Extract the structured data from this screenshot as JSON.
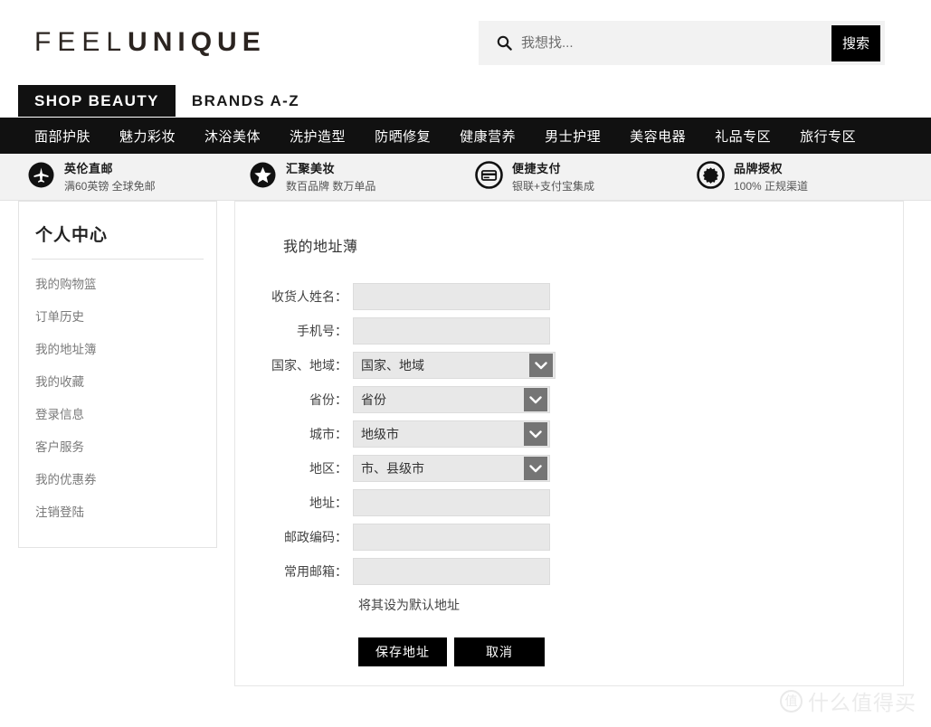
{
  "header": {
    "logo_light": "FEEL",
    "logo_bold": "UNIQUE",
    "search": {
      "placeholder": "我想找...",
      "value": "",
      "button_label": "搜索",
      "icon": "search-icon"
    }
  },
  "tabs": [
    {
      "label": "SHOP BEAUTY",
      "active": true
    },
    {
      "label": "BRANDS A-Z",
      "active": false
    }
  ],
  "nav": {
    "items": [
      {
        "label": "面部护肤"
      },
      {
        "label": "魅力彩妆"
      },
      {
        "label": "沐浴美体"
      },
      {
        "label": "洗护造型"
      },
      {
        "label": "防晒修复"
      },
      {
        "label": "健康营养"
      },
      {
        "label": "男士护理"
      },
      {
        "label": "美容电器"
      },
      {
        "label": "礼品专区"
      },
      {
        "label": "旅行专区"
      }
    ]
  },
  "features": [
    {
      "icon": "airplane-icon",
      "title": "英伦直邮",
      "sub": "满60英镑 全球免邮"
    },
    {
      "icon": "star-icon",
      "title": "汇聚美妆",
      "sub": "数百品牌 数万单品"
    },
    {
      "icon": "credit-card-icon",
      "title": "便捷支付",
      "sub": "银联+支付宝集成"
    },
    {
      "icon": "seal-icon",
      "title": "品牌授权",
      "sub": "100% 正规渠道"
    }
  ],
  "sidebar": {
    "title": "个人中心",
    "items": [
      {
        "label": "我的购物篮"
      },
      {
        "label": "订单历史"
      },
      {
        "label": "我的地址簿"
      },
      {
        "label": "我的收藏"
      },
      {
        "label": "登录信息"
      },
      {
        "label": "客户服务"
      },
      {
        "label": "我的优惠券"
      },
      {
        "label": "注销登陆"
      }
    ]
  },
  "main": {
    "title": "我的地址薄",
    "fields": [
      {
        "label": "收货人姓名：",
        "type": "text",
        "value": "",
        "placeholder": ""
      },
      {
        "label": "手机号：",
        "type": "text",
        "value": "",
        "placeholder": ""
      },
      {
        "label": "国家、地域：",
        "type": "select",
        "value": "国家、地域"
      },
      {
        "label": "省份：",
        "type": "select",
        "value": "省份"
      },
      {
        "label": "城市：",
        "type": "select",
        "value": "地级市"
      },
      {
        "label": "地区：",
        "type": "select",
        "value": "市、县级市"
      },
      {
        "label": "地址：",
        "type": "text",
        "value": "",
        "placeholder": ""
      },
      {
        "label": "邮政编码：",
        "type": "text",
        "value": "",
        "placeholder": ""
      },
      {
        "label": "常用邮箱：",
        "type": "text",
        "value": "",
        "placeholder": ""
      }
    ],
    "default_address_label": "将其设为默认地址",
    "save_label": "保存地址",
    "cancel_label": "取消"
  },
  "watermark": {
    "mark": "值",
    "text": "什么值得买"
  },
  "colors": {
    "accent_black": "#000000",
    "nav_bg": "#111111",
    "field_bg": "#e8e8e8",
    "arrow_bg": "#757575",
    "strip_bg": "#f2f2f2"
  }
}
